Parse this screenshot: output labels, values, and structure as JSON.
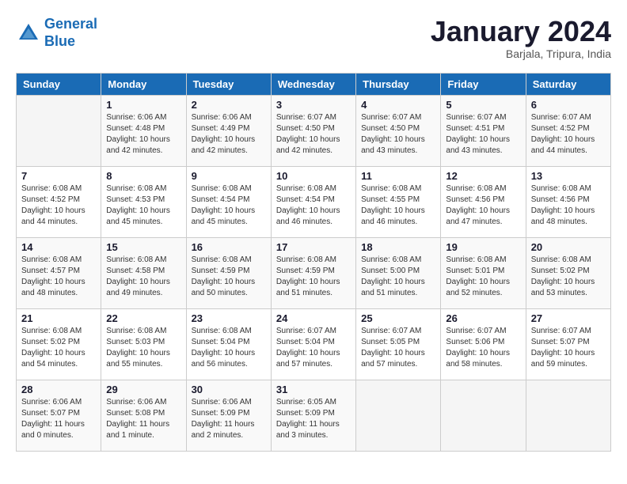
{
  "header": {
    "logo_line1": "General",
    "logo_line2": "Blue",
    "month_title": "January 2024",
    "subtitle": "Barjala, Tripura, India"
  },
  "columns": [
    "Sunday",
    "Monday",
    "Tuesday",
    "Wednesday",
    "Thursday",
    "Friday",
    "Saturday"
  ],
  "weeks": [
    [
      {
        "day": "",
        "info": ""
      },
      {
        "day": "1",
        "info": "Sunrise: 6:06 AM\nSunset: 4:48 PM\nDaylight: 10 hours\nand 42 minutes."
      },
      {
        "day": "2",
        "info": "Sunrise: 6:06 AM\nSunset: 4:49 PM\nDaylight: 10 hours\nand 42 minutes."
      },
      {
        "day": "3",
        "info": "Sunrise: 6:07 AM\nSunset: 4:50 PM\nDaylight: 10 hours\nand 42 minutes."
      },
      {
        "day": "4",
        "info": "Sunrise: 6:07 AM\nSunset: 4:50 PM\nDaylight: 10 hours\nand 43 minutes."
      },
      {
        "day": "5",
        "info": "Sunrise: 6:07 AM\nSunset: 4:51 PM\nDaylight: 10 hours\nand 43 minutes."
      },
      {
        "day": "6",
        "info": "Sunrise: 6:07 AM\nSunset: 4:52 PM\nDaylight: 10 hours\nand 44 minutes."
      }
    ],
    [
      {
        "day": "7",
        "info": "Sunrise: 6:08 AM\nSunset: 4:52 PM\nDaylight: 10 hours\nand 44 minutes."
      },
      {
        "day": "8",
        "info": "Sunrise: 6:08 AM\nSunset: 4:53 PM\nDaylight: 10 hours\nand 45 minutes."
      },
      {
        "day": "9",
        "info": "Sunrise: 6:08 AM\nSunset: 4:54 PM\nDaylight: 10 hours\nand 45 minutes."
      },
      {
        "day": "10",
        "info": "Sunrise: 6:08 AM\nSunset: 4:54 PM\nDaylight: 10 hours\nand 46 minutes."
      },
      {
        "day": "11",
        "info": "Sunrise: 6:08 AM\nSunset: 4:55 PM\nDaylight: 10 hours\nand 46 minutes."
      },
      {
        "day": "12",
        "info": "Sunrise: 6:08 AM\nSunset: 4:56 PM\nDaylight: 10 hours\nand 47 minutes."
      },
      {
        "day": "13",
        "info": "Sunrise: 6:08 AM\nSunset: 4:56 PM\nDaylight: 10 hours\nand 48 minutes."
      }
    ],
    [
      {
        "day": "14",
        "info": "Sunrise: 6:08 AM\nSunset: 4:57 PM\nDaylight: 10 hours\nand 48 minutes."
      },
      {
        "day": "15",
        "info": "Sunrise: 6:08 AM\nSunset: 4:58 PM\nDaylight: 10 hours\nand 49 minutes."
      },
      {
        "day": "16",
        "info": "Sunrise: 6:08 AM\nSunset: 4:59 PM\nDaylight: 10 hours\nand 50 minutes."
      },
      {
        "day": "17",
        "info": "Sunrise: 6:08 AM\nSunset: 4:59 PM\nDaylight: 10 hours\nand 51 minutes."
      },
      {
        "day": "18",
        "info": "Sunrise: 6:08 AM\nSunset: 5:00 PM\nDaylight: 10 hours\nand 51 minutes."
      },
      {
        "day": "19",
        "info": "Sunrise: 6:08 AM\nSunset: 5:01 PM\nDaylight: 10 hours\nand 52 minutes."
      },
      {
        "day": "20",
        "info": "Sunrise: 6:08 AM\nSunset: 5:02 PM\nDaylight: 10 hours\nand 53 minutes."
      }
    ],
    [
      {
        "day": "21",
        "info": "Sunrise: 6:08 AM\nSunset: 5:02 PM\nDaylight: 10 hours\nand 54 minutes."
      },
      {
        "day": "22",
        "info": "Sunrise: 6:08 AM\nSunset: 5:03 PM\nDaylight: 10 hours\nand 55 minutes."
      },
      {
        "day": "23",
        "info": "Sunrise: 6:08 AM\nSunset: 5:04 PM\nDaylight: 10 hours\nand 56 minutes."
      },
      {
        "day": "24",
        "info": "Sunrise: 6:07 AM\nSunset: 5:04 PM\nDaylight: 10 hours\nand 57 minutes."
      },
      {
        "day": "25",
        "info": "Sunrise: 6:07 AM\nSunset: 5:05 PM\nDaylight: 10 hours\nand 57 minutes."
      },
      {
        "day": "26",
        "info": "Sunrise: 6:07 AM\nSunset: 5:06 PM\nDaylight: 10 hours\nand 58 minutes."
      },
      {
        "day": "27",
        "info": "Sunrise: 6:07 AM\nSunset: 5:07 PM\nDaylight: 10 hours\nand 59 minutes."
      }
    ],
    [
      {
        "day": "28",
        "info": "Sunrise: 6:06 AM\nSunset: 5:07 PM\nDaylight: 11 hours\nand 0 minutes."
      },
      {
        "day": "29",
        "info": "Sunrise: 6:06 AM\nSunset: 5:08 PM\nDaylight: 11 hours\nand 1 minute."
      },
      {
        "day": "30",
        "info": "Sunrise: 6:06 AM\nSunset: 5:09 PM\nDaylight: 11 hours\nand 2 minutes."
      },
      {
        "day": "31",
        "info": "Sunrise: 6:05 AM\nSunset: 5:09 PM\nDaylight: 11 hours\nand 3 minutes."
      },
      {
        "day": "",
        "info": ""
      },
      {
        "day": "",
        "info": ""
      },
      {
        "day": "",
        "info": ""
      }
    ]
  ]
}
